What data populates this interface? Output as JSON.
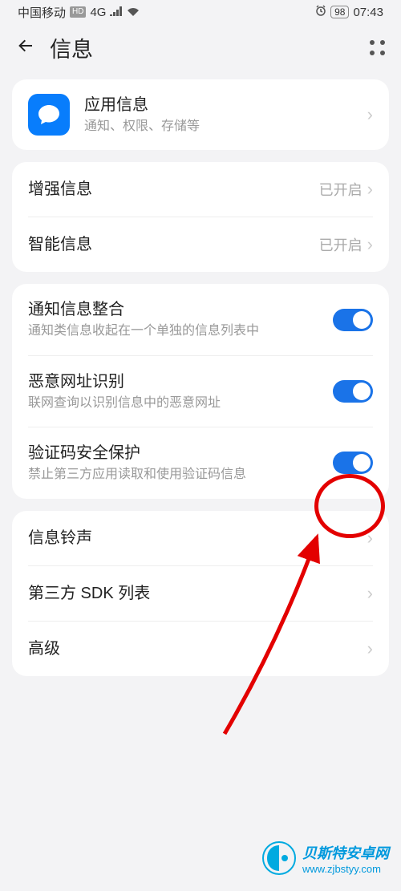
{
  "statusBar": {
    "carrier": "中国移动",
    "hdBadge": "HD",
    "network": "4G",
    "battery": "98",
    "time": "07:43"
  },
  "nav": {
    "title": "信息"
  },
  "appInfo": {
    "title": "应用信息",
    "subtitle": "通知、权限、存储等"
  },
  "group1": {
    "enhanced": {
      "title": "增强信息",
      "value": "已开启"
    },
    "smart": {
      "title": "智能信息",
      "value": "已开启"
    }
  },
  "group2": {
    "merge": {
      "title": "通知信息整合",
      "subtitle": "通知类信息收起在一个单独的信息列表中"
    },
    "malicious": {
      "title": "恶意网址识别",
      "subtitle": "联网查询以识别信息中的恶意网址"
    },
    "verify": {
      "title": "验证码安全保护",
      "subtitle": "禁止第三方应用读取和使用验证码信息"
    }
  },
  "group3": {
    "ringtone": {
      "title": "信息铃声"
    },
    "sdk": {
      "title": "第三方 SDK 列表"
    },
    "advanced": {
      "title": "高级"
    }
  },
  "watermark": {
    "title": "贝斯特安卓网",
    "url": "www.zjbstyy.com"
  }
}
